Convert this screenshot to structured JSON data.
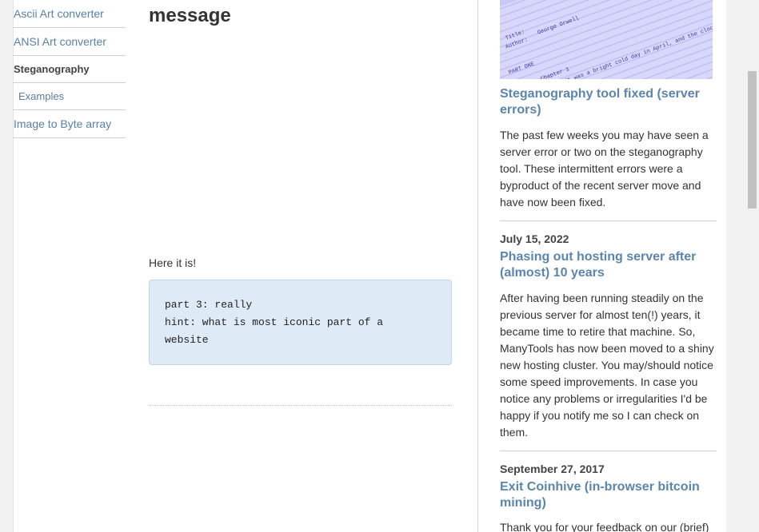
{
  "nav": {
    "items": [
      {
        "label": "Ascii Art converter"
      },
      {
        "label": "ANSI Art converter"
      },
      {
        "label": "Steganography"
      },
      {
        "label": "Examples"
      },
      {
        "label": "Image to Byte array"
      }
    ]
  },
  "content": {
    "heading": "message",
    "intro": "Here it is!",
    "code_lines": [
      "part 3: really",
      "hint: what is most iconic part of a",
      "website"
    ]
  },
  "sidebar": {
    "thumbnail_text": [
      "Title:",
      "Author:",
      "George Orwell",
      "PART ONE",
      "Chapter 1",
      "It was a bright cold day in April, and the clocks were striking"
    ],
    "posts": [
      {
        "title": "Steganography tool fixed (server errors)",
        "body": "The past few weeks you may have seen a server error or two on the steganography tool. These intermittent errors were a byproduct of the recent server move and have now been fixed."
      },
      {
        "date": "July 15, 2022",
        "title": "Phasing out hosting server after (almost) 10 years",
        "body": "After having been running steadily on the previous server for almost ten(!) years, it became time to retire that machine. So, ManyTools has now been moved to a shiny new hosting cluster. You may/should notice some speed improvements. In case you notice any problems or irregularities I'd be happy if you notify me so I can check on them."
      },
      {
        "date": "September 27, 2017",
        "title": "Exit Coinhive (in-browser bitcoin mining)",
        "body": "Thank you for your feedback on our (brief)"
      }
    ]
  },
  "colors": {
    "link": "#5b85ad",
    "code_bg": "#dfeaf7",
    "thumb_bg": "#c9c8f6"
  }
}
